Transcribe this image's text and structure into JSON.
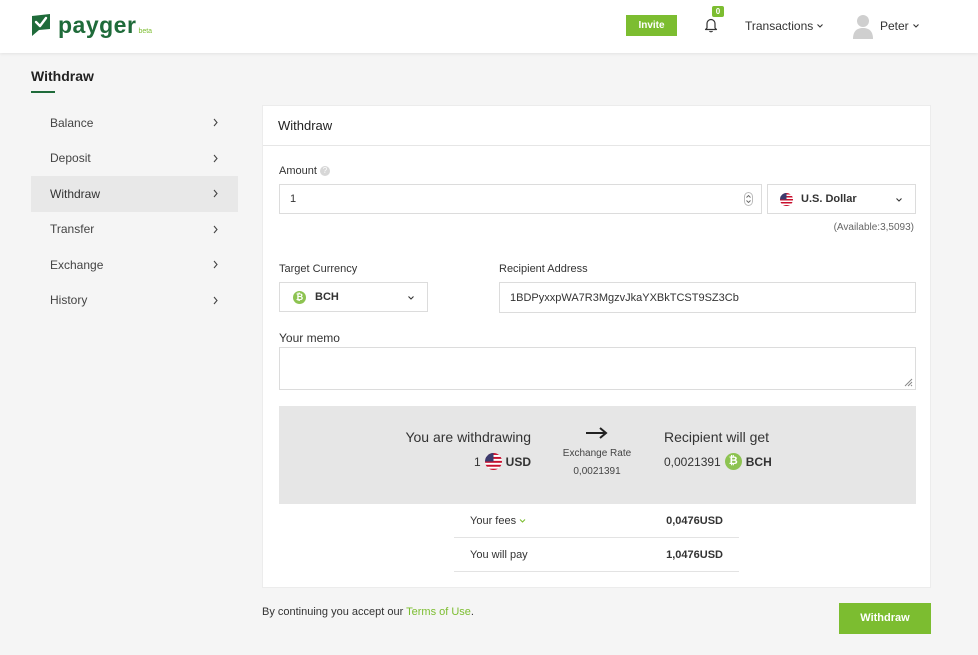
{
  "brand": {
    "name": "payger",
    "badge": "beta"
  },
  "header": {
    "invite_label": "Invite",
    "notification_count": "0",
    "transactions_label": "Transactions",
    "user_name": "Peter"
  },
  "page": {
    "title": "Withdraw"
  },
  "sidebar": {
    "items": [
      {
        "label": "Balance"
      },
      {
        "label": "Deposit"
      },
      {
        "label": "Withdraw",
        "active": true
      },
      {
        "label": "Transfer"
      },
      {
        "label": "Exchange"
      },
      {
        "label": "History"
      }
    ]
  },
  "form": {
    "card_title": "Withdraw",
    "amount_label": "Amount",
    "amount_value": "1",
    "currency_selected": "U.S. Dollar",
    "available_text": "(Available:3,5093)",
    "target_currency_label": "Target Currency",
    "target_currency_selected": "BCH",
    "recipient_label": "Recipient Address",
    "recipient_value": "1BDPyxxpWA7R3MgzvJkaYXBkTCST9SZ3Cb",
    "memo_label": "Your memo",
    "memo_value": ""
  },
  "summary": {
    "left_title": "You are withdrawing",
    "left_amount": "1",
    "left_currency": "USD",
    "rate_label": "Exchange Rate",
    "rate_value": "0,0021391",
    "right_title": "Recipient will get",
    "right_amount": "0,0021391",
    "right_currency": "BCH"
  },
  "fees": {
    "fees_label": "Your fees",
    "fees_value": "0,0476USD",
    "pay_label": "You will pay",
    "pay_value": "1,0476USD"
  },
  "footer": {
    "note_prefix": "By continuing you accept our ",
    "terms_label": "Terms of Use",
    "note_suffix": ".",
    "withdraw_label": "Withdraw"
  },
  "colors": {
    "brand_dark": "#1f6b3a",
    "accent": "#7cbd30",
    "bch": "#8dc351"
  }
}
